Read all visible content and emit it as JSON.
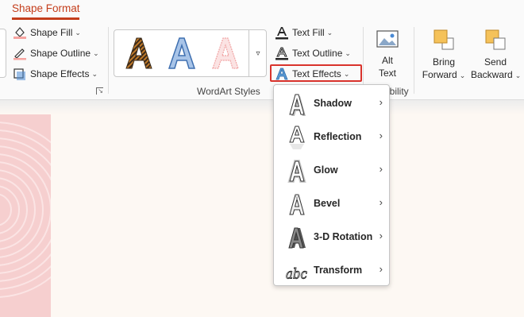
{
  "tab": {
    "active_label": "Shape Format"
  },
  "shape_styles": {
    "fill_label": "Shape Fill",
    "outline_label": "Shape Outline",
    "effects_label": "Shape Effects"
  },
  "wordart": {
    "group_label": "WordArt Styles",
    "gallery_letter": "A",
    "text_fill_label": "Text Fill",
    "text_outline_label": "Text Outline",
    "text_effects_label": "Text Effects"
  },
  "accessibility": {
    "alt_text_line1": "Alt",
    "alt_text_line2": "Text",
    "group_label_partial": "ibility"
  },
  "arrange": {
    "bring_forward_line1": "Bring",
    "bring_forward_line2": "Forward",
    "send_backward_line1": "Send",
    "send_backward_line2": "Backward"
  },
  "text_effects_menu": {
    "items": [
      {
        "label": "Shadow",
        "icon": "shadow-a-icon"
      },
      {
        "label": "Reflection",
        "icon": "reflection-a-icon"
      },
      {
        "label": "Glow",
        "icon": "glow-a-icon"
      },
      {
        "label": "Bevel",
        "icon": "bevel-a-icon"
      },
      {
        "label": "3-D Rotation",
        "icon": "3d-rotation-a-icon"
      },
      {
        "label": "Transform",
        "icon": "transform-abc-icon"
      }
    ]
  },
  "colors": {
    "accent": "#c43e1c",
    "highlight_box": "#d9332c",
    "slide_background": "#fdf8f3",
    "slide_panel": "#f6cfcf"
  }
}
